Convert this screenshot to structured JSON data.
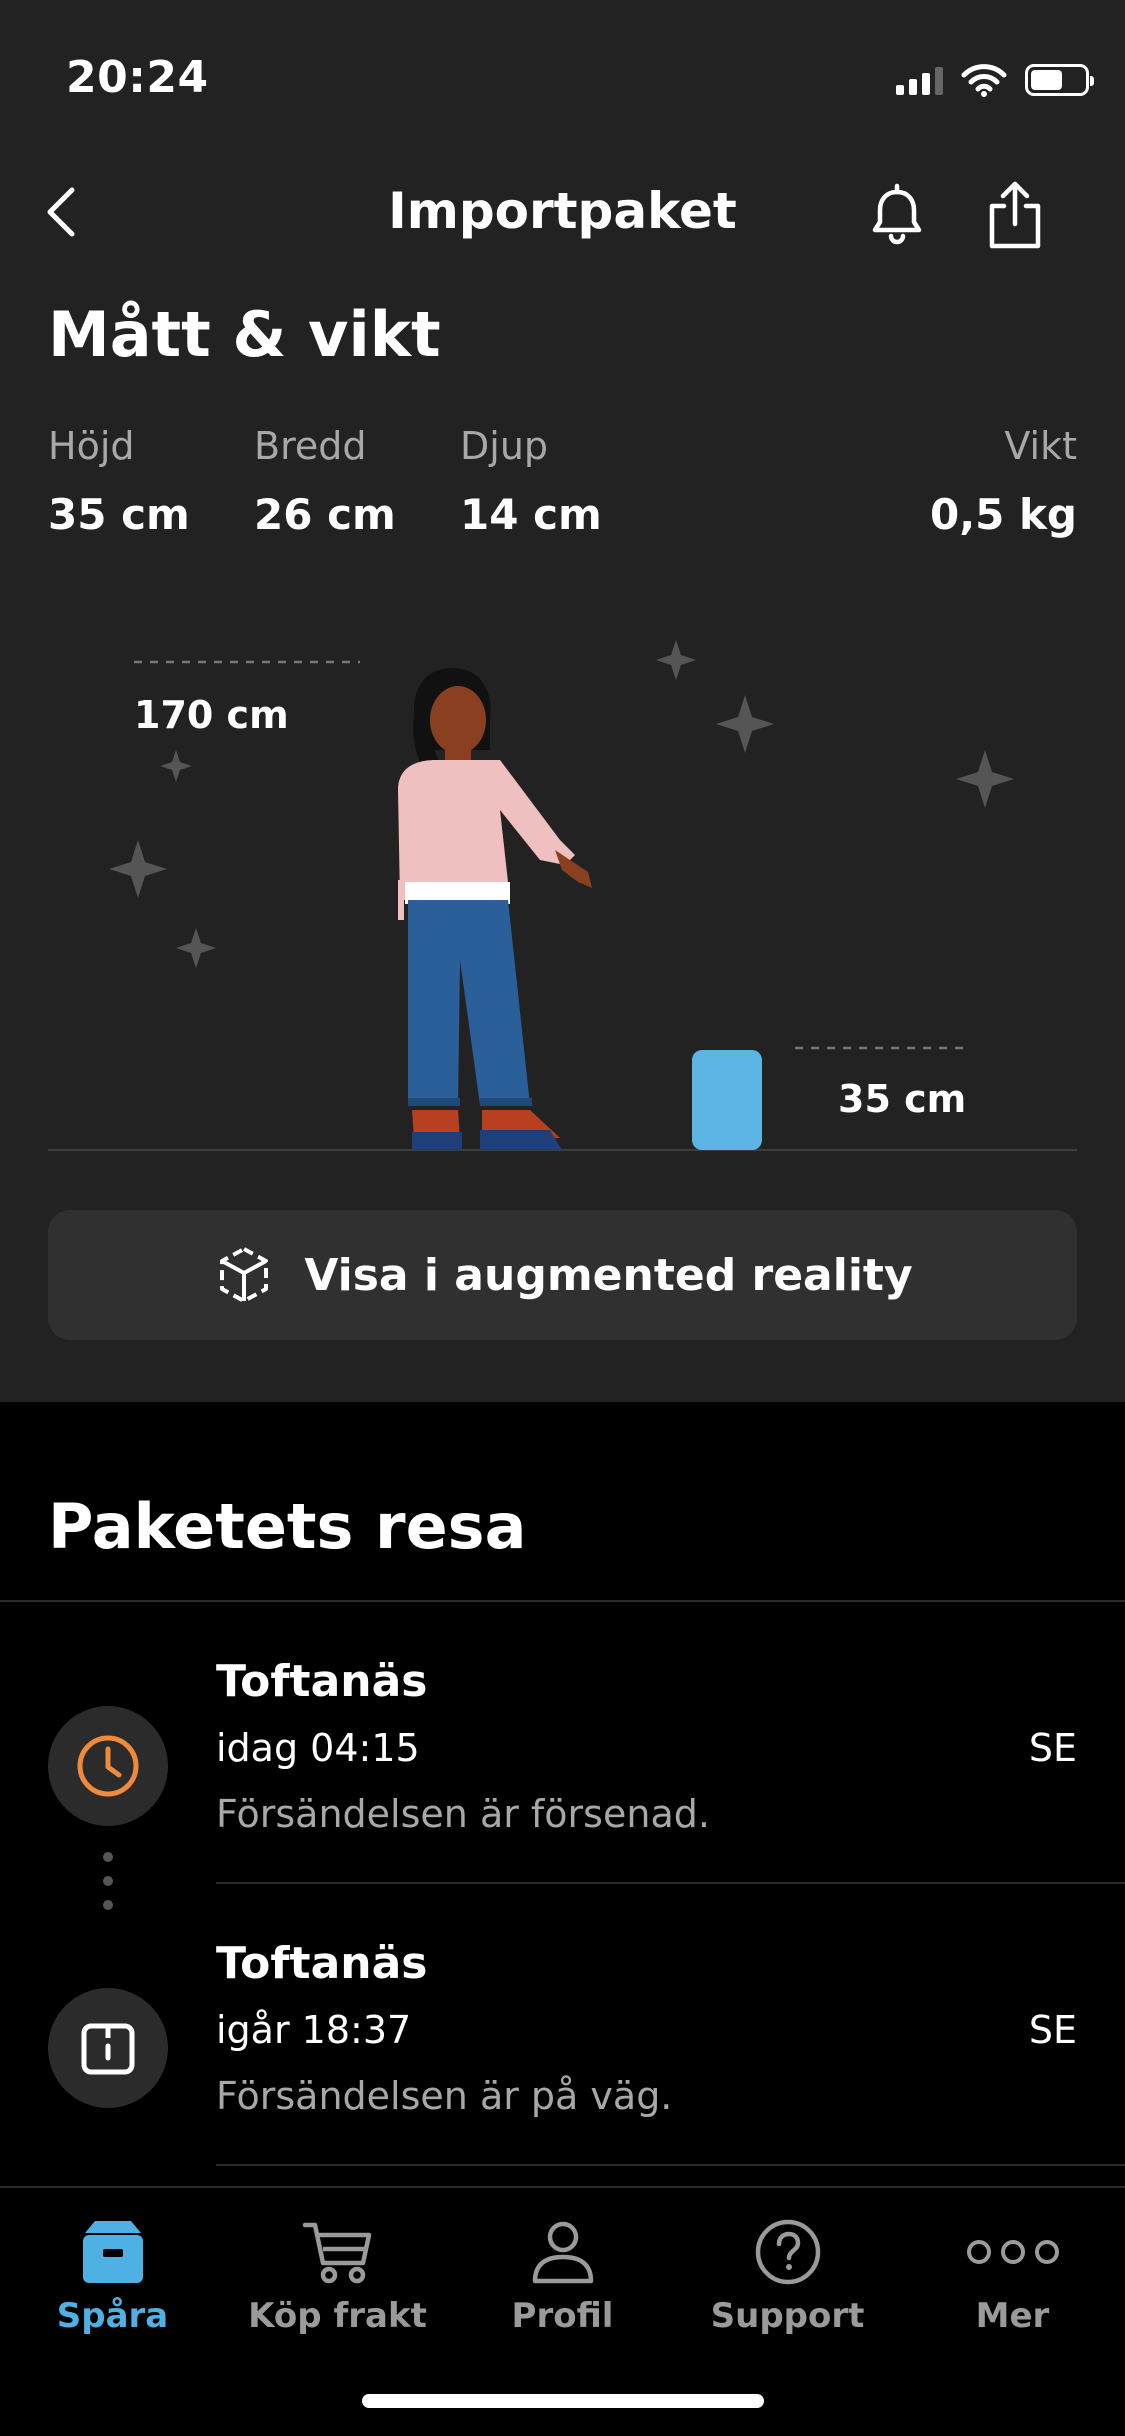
{
  "status_bar": {
    "time": "20:24",
    "battery_level": 0.6
  },
  "nav": {
    "title": "Importpaket"
  },
  "dimensions": {
    "title": "Mått & vikt",
    "items": [
      {
        "label": "Höjd",
        "value": "35 cm"
      },
      {
        "label": "Bredd",
        "value": "26 cm"
      },
      {
        "label": "Djup",
        "value": "14 cm"
      },
      {
        "label": "Vikt",
        "value": "0,5 kg"
      }
    ],
    "person_height": "170 cm",
    "package_height": "35 cm"
  },
  "ar_button": {
    "label": "Visa i augmented reality"
  },
  "journey": {
    "title": "Paketets resa",
    "events": [
      {
        "place": "Toftanäs",
        "time": "idag 04:15",
        "description": "Försändelsen är försenad.",
        "country": "SE",
        "icon": "clock-icon",
        "icon_color": "#f08a3c"
      },
      {
        "place": "Toftanäs",
        "time": "igår 18:37",
        "description": "Försändelsen är på väg.",
        "country": "SE",
        "icon": "package-icon",
        "icon_color": "#ffffff"
      }
    ]
  },
  "tabs": [
    {
      "label": "Spåra",
      "icon": "package-track-icon",
      "active": true
    },
    {
      "label": "Köp frakt",
      "icon": "cart-icon",
      "active": false
    },
    {
      "label": "Profil",
      "icon": "person-icon",
      "active": false
    },
    {
      "label": "Support",
      "icon": "question-icon",
      "active": false
    },
    {
      "label": "Mer",
      "icon": "more-dots-icon",
      "active": false
    }
  ],
  "colors": {
    "accent": "#4fb0e3",
    "package": "#5cb4e4",
    "warning": "#f08a3c",
    "panel_bg": "#222222"
  }
}
